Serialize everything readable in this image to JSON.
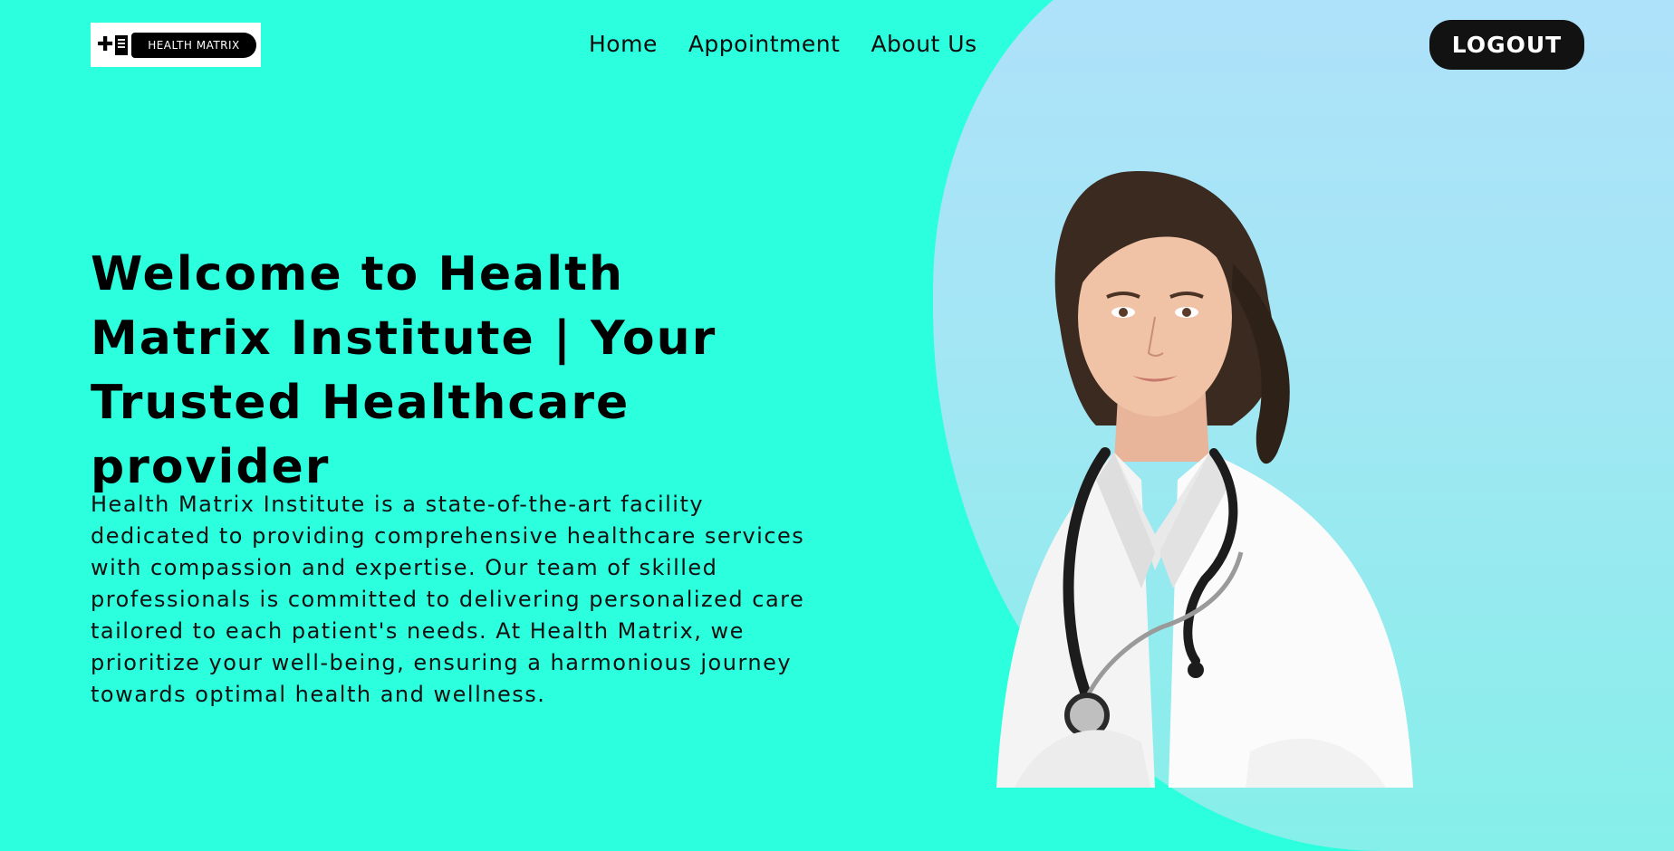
{
  "logo": {
    "text": "HEALTH MATRIX"
  },
  "nav": {
    "items": [
      "Home",
      "Appointment",
      "About Us"
    ]
  },
  "header": {
    "logout_label": "LOGOUT"
  },
  "hero": {
    "title": "Welcome to Health Matrix Institute | Your Trusted Healthcare provider",
    "description": "Health Matrix Institute is a state-of-the-art facility dedicated to providing comprehensive healthcare services with compassion and expertise. Our team of skilled professionals is committed to delivering personalized care tailored to each patient's needs. At Health Matrix, we prioritize your well-being, ensuring a harmonious journey towards optimal health and wellness."
  },
  "colors": {
    "background": "#2bffdd",
    "blob": "#b0e1fb",
    "button": "#121212"
  },
  "icons": [
    "medical-cross-icon",
    "hospital-building-icon"
  ]
}
